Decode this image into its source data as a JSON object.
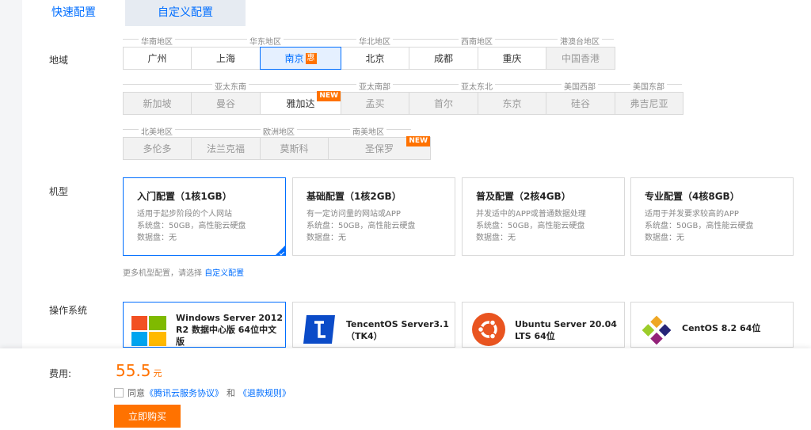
{
  "tabs": {
    "quick": "快速配置",
    "custom": "自定义配置"
  },
  "labels": {
    "region": "地域",
    "machine": "机型",
    "os": "操作系统",
    "fee": "费用:"
  },
  "regions": {
    "row1_groups": [
      "华南地区",
      "华东地区",
      "华北地区",
      "西南地区",
      "港澳台地区"
    ],
    "row1": [
      "广州",
      "上海",
      "南京",
      "北京",
      "成都",
      "重庆",
      "中国香港"
    ],
    "nanjing_badge": "惠",
    "row2_groups": [
      "亚太东南",
      "亚太南部",
      "亚太东北",
      "美国西部",
      "美国东部"
    ],
    "row2": [
      "新加坡",
      "曼谷",
      "雅加达",
      "孟买",
      "首尔",
      "东京",
      "硅谷",
      "弗吉尼亚"
    ],
    "row3_groups": [
      "北美地区",
      "欧洲地区",
      "南美地区"
    ],
    "row3": [
      "多伦多",
      "法兰克福",
      "莫斯科",
      "圣保罗"
    ],
    "new_tag": "NEW"
  },
  "machines": [
    {
      "title": "入门配置（1核1GB）",
      "desc": "适用于起步阶段的个人网站",
      "sys": "系统盘：50GB，高性能云硬盘",
      "data": "数据盘：无"
    },
    {
      "title": "基础配置（1核2GB）",
      "desc": "有一定访问量的网站或APP",
      "sys": "系统盘：50GB，高性能云硬盘",
      "data": "数据盘：无"
    },
    {
      "title": "普及配置（2核4GB）",
      "desc": "并发适中的APP或普通数据处理",
      "sys": "系统盘：50GB，高性能云硬盘",
      "data": "数据盘：无"
    },
    {
      "title": "专业配置（4核8GB）",
      "desc": "适用于并发要求较高的APP",
      "sys": "系统盘：50GB，高性能云硬盘",
      "data": "数据盘：无"
    }
  ],
  "more": {
    "text": "更多机型配置，请选择",
    "link": "自定义配置"
  },
  "os": [
    {
      "line1": "Windows Server 2012",
      "line2": "R2 数据中心版 64位中文",
      "line3": "版",
      "icon": "windows-icon"
    },
    {
      "line1": "TencentOS Server3.1",
      "line2": "（TK4）",
      "icon": "tencentos-icon"
    },
    {
      "line1": "Ubuntu Server 20.04",
      "line2": "LTS 64位",
      "icon": "ubuntu-icon"
    },
    {
      "line1": "CentOS 8.2 64位",
      "icon": "centos-icon"
    }
  ],
  "footer": {
    "price": "55.5",
    "unit": "元",
    "agree_prefix": "同意",
    "agreement": "《腾讯云服务协议》",
    "and": "和",
    "refund": "《退款规则》",
    "buy": "立即购买"
  },
  "colors": {
    "accent": "#006eff",
    "orange": "#ff7200"
  }
}
